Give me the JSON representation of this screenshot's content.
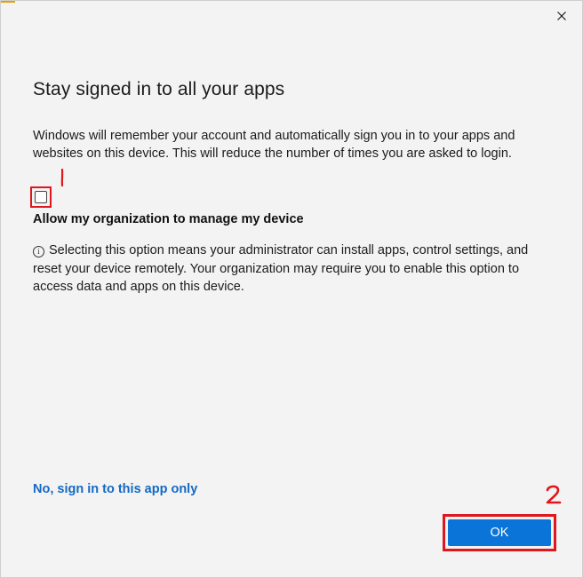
{
  "dialog": {
    "close_label": "×",
    "title": "Stay signed in to all your apps",
    "description": "Windows will remember your account and automatically sign you in to your apps and websites on this device. This will reduce the number of times you are asked to login.",
    "checkbox": {
      "checked": false,
      "label": "Allow my organization to manage my device"
    },
    "info": {
      "icon": "info-icon",
      "icon_glyph": "i",
      "text": "Selecting this option means your administrator can install apps, control settings, and reset your device remotely. Your organization may require you to enable this option to access data and apps on this device."
    },
    "link_label": "No, sign in to this app only",
    "ok_label": "OK"
  },
  "annotations": {
    "step1": "1",
    "step2": "2",
    "color": "#e0161e"
  },
  "colors": {
    "background": "#f3f3f3",
    "link": "#1369c3",
    "primary_button": "#0a74d9",
    "accent_top": "#e8a100"
  }
}
